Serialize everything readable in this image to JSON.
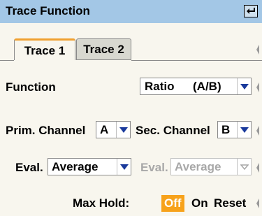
{
  "title": "Trace Function",
  "tabs": [
    {
      "label": "Trace 1",
      "active": true
    },
    {
      "label": "Trace 2",
      "active": false
    }
  ],
  "function": {
    "label": "Function",
    "value_main": "Ratio",
    "value_sub": "(A/B)"
  },
  "channels": {
    "prim_label": "Prim. Channel",
    "prim_value": "A",
    "sec_label": "Sec. Channel",
    "sec_value": "B"
  },
  "eval": {
    "label1": "Eval.",
    "value1": "Average",
    "label2": "Eval.",
    "value2": "Average"
  },
  "max_hold": {
    "label": "Max Hold:",
    "off": "Off",
    "on": "On",
    "reset": "Reset",
    "selected": "Off"
  },
  "colors": {
    "accent": "#f7a21b",
    "titlebar": "#a3c7e6"
  }
}
